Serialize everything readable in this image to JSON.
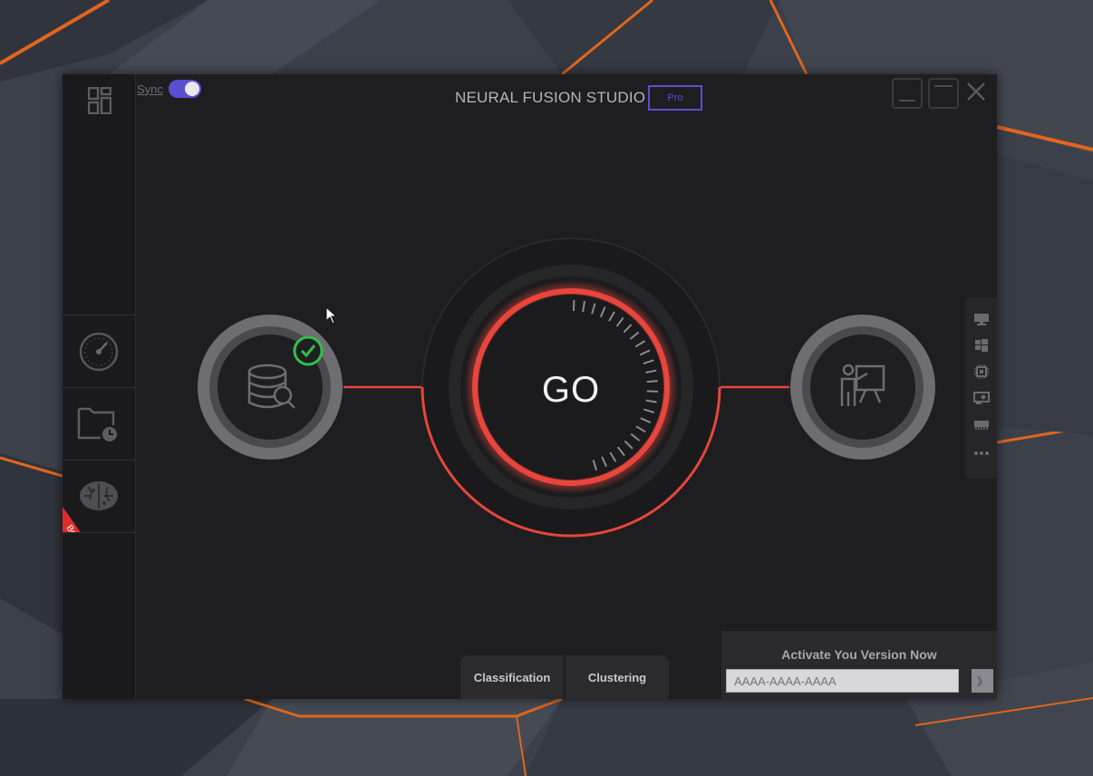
{
  "app": {
    "title": "NEURAL FUSION STUDIO",
    "edition_badge": "Pro",
    "sync_label": "Sync",
    "sync_on": true
  },
  "sidebar": {
    "items": [
      {
        "name": "dashboard",
        "icon": "grid-icon"
      },
      {
        "name": "speed",
        "icon": "speedometer-icon"
      },
      {
        "name": "scheduled-folder",
        "icon": "folder-clock-icon"
      },
      {
        "name": "ai-brain",
        "icon": "brain-icon",
        "ribbon": "Beta"
      }
    ]
  },
  "main": {
    "go_label": "GO",
    "left_node": {
      "icon": "database-search-icon",
      "status": "check"
    },
    "right_node": {
      "icon": "presenter-icon"
    }
  },
  "right_rail": {
    "icons": [
      "monitor-icon",
      "windows-icon",
      "cpu-icon",
      "gpu-icon",
      "memory-icon",
      "more-icon"
    ]
  },
  "tabs": [
    "Classification",
    "Clustering"
  ],
  "activation": {
    "title": "Activate You  Version Now",
    "key_placeholder": "AAAA-AAAA-AAAA",
    "submit_label": "》"
  },
  "colors": {
    "accent_red": "#e8453c",
    "toggle_purple": "#5a4fd1",
    "check_green": "#2fbf4a"
  }
}
